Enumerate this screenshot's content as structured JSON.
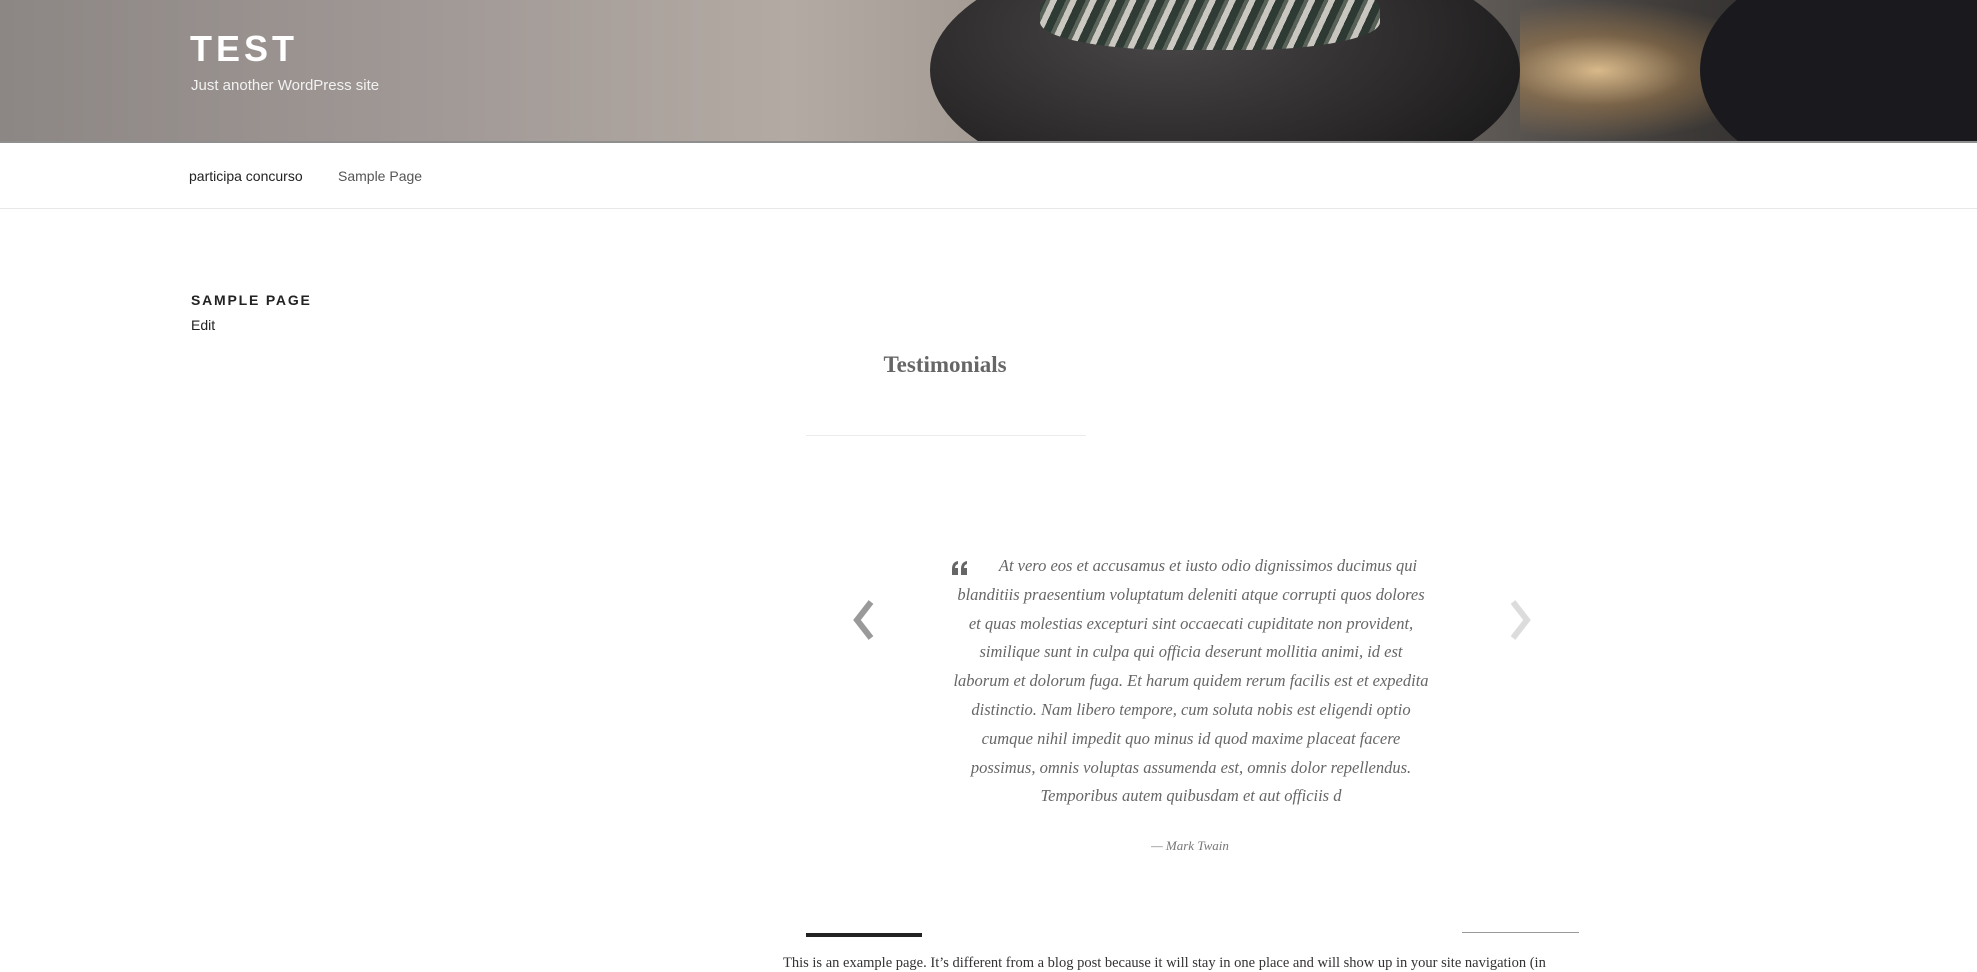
{
  "header": {
    "site_title": "TEST",
    "tagline": "Just another WordPress site"
  },
  "nav": {
    "items": [
      {
        "label": "participa concurso"
      },
      {
        "label": "Sample Page"
      }
    ]
  },
  "page": {
    "heading": "SAMPLE PAGE",
    "edit_label": "Edit"
  },
  "testimonials": {
    "title": "Testimonials",
    "quote": "At vero eos et accusamus et iusto odio dignissimos ducimus qui blanditiis praesentium voluptatum deleniti atque corrupti quos dolores et quas molestias excepturi sint occaecati cupiditate non provident, similique sunt in culpa qui officia deserunt mollitia animi, id est laborum et dolorum fuga. Et harum quidem rerum facilis est et expedita distinctio. Nam libero tempore, cum soluta nobis est eligendi optio cumque nihil impedit quo minus id quod maxime placeat facere possimus, omnis voluptas assumenda est, omnis dolor repellendus. Temporibus autem quibusdam et aut officiis d",
    "author": "— Mark Twain",
    "icons": {
      "prev": "chevron-left-icon",
      "next": "chevron-right-icon",
      "quote": "quote-icon"
    }
  },
  "content": {
    "body_text": "This is an example page. It’s different from a blog post because it will stay in one place and will show up in your site navigation (in"
  },
  "colors": {
    "accent_dark": "#222222",
    "text_muted": "#666666",
    "background": "#ffffff"
  }
}
